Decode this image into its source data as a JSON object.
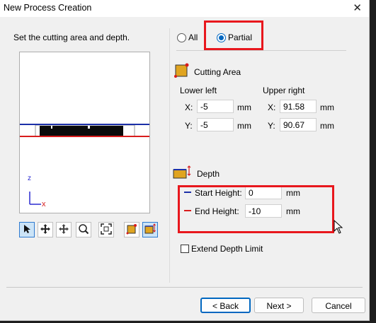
{
  "window": {
    "title": "New Process Creation",
    "close_glyph": "✕"
  },
  "instruction": "Set the cutting area and depth.",
  "mode": {
    "all_label": "All",
    "partial_label": "Partial",
    "selected": "Partial"
  },
  "cutting_area": {
    "label": "Cutting Area",
    "icon": "cutting-area-icon",
    "lower_left": {
      "label": "Lower left",
      "x_label": "X:",
      "x_value": "-5",
      "y_label": "Y:",
      "y_value": "-5",
      "unit": "mm"
    },
    "upper_right": {
      "label": "Upper right",
      "x_label": "X:",
      "x_value": "91.58",
      "y_label": "Y:",
      "y_value": "90.67",
      "unit": "mm"
    }
  },
  "depth": {
    "label": "Depth",
    "icon": "depth-icon",
    "start_label": "Start Height:",
    "start_value": "0",
    "start_unit": "mm",
    "start_color": "#1b2fa8",
    "end_label": "End Height:",
    "end_value": "-10",
    "end_unit": "mm",
    "end_color": "#d81c1c"
  },
  "extend_depth": {
    "label": "Extend Depth Limit",
    "checked": false
  },
  "axis": {
    "z_label": "z"
  },
  "toolbar": {
    "tools": [
      "select-arrow-icon",
      "pan-icon",
      "move-icon",
      "zoom-icon",
      "fit-icon",
      "cutting-area-tool-icon",
      "depth-tool-icon"
    ],
    "active": [
      "select-arrow-icon",
      "depth-tool-icon"
    ]
  },
  "buttons": {
    "back": "< Back",
    "next": "Next >",
    "cancel": "Cancel"
  },
  "colors": {
    "highlight": "#e8171d",
    "accent": "#0067c0",
    "icon_fill": "#e0a420"
  }
}
